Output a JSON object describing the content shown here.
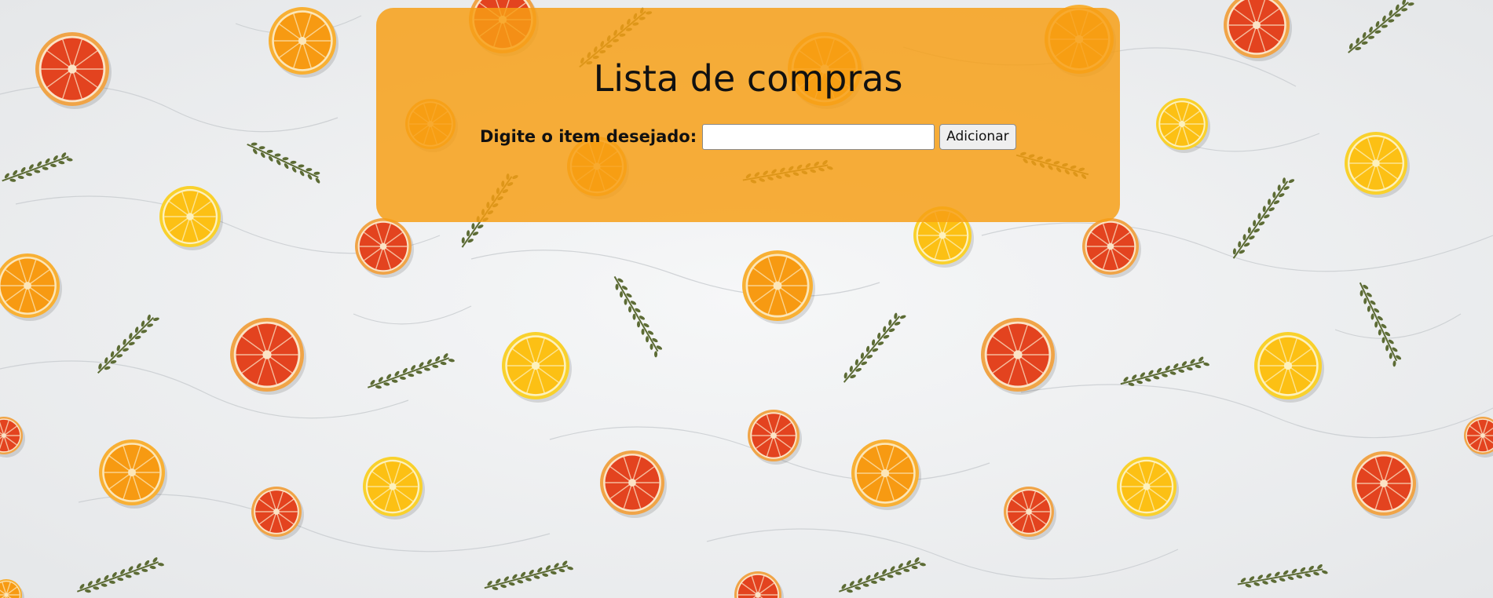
{
  "page": {
    "title": "Lista de compras"
  },
  "form": {
    "label": "Digite o item desejado:",
    "input_value": "",
    "input_placeholder": "",
    "add_button_label": "Adicionar"
  },
  "colors": {
    "card_background": "#f79e14",
    "marble_background": "#eef0f1",
    "orange_slice": "#f79a12",
    "lemon_slice": "#fcc014",
    "grapefruit_slice": "#e3431f",
    "herb": "#5c6b34"
  },
  "background": {
    "decor": [
      "orange-slice",
      "lemon-slice",
      "grapefruit-slice",
      "thyme-sprig",
      "marble-texture"
    ]
  }
}
